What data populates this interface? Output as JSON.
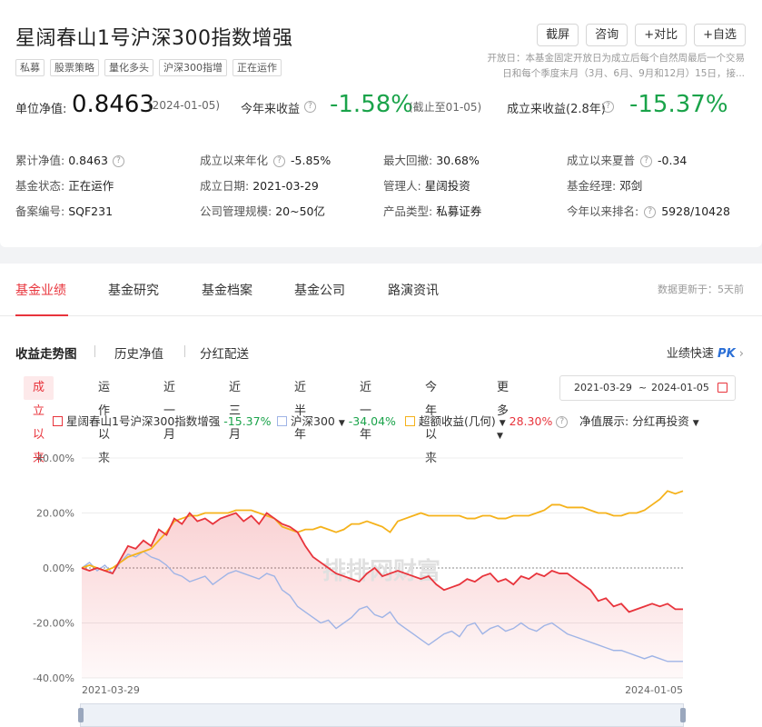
{
  "fund": {
    "title": "星阔春山1号沪深300指数增强",
    "buttons": [
      "截屏",
      "咨询",
      "+对比",
      "+自选"
    ],
    "tags": [
      "私募",
      "股票策略",
      "量化多头",
      "沪深300指增",
      "正在运作"
    ],
    "open_note": "开放日：本基金固定开放日为成立后每个自然周最后一个交易日和每个季度末月（3月、6月、9月和12月）15日，接..."
  },
  "summary": {
    "nav_label": "单位净值:",
    "nav_value": "0.8463",
    "nav_date": "(2024-01-05)",
    "ytd_label": "今年来收益",
    "ytd_value": "-1.58%",
    "ytd_note": "(截止至01-05)",
    "since_label": "成立来收益(2.8年)",
    "since_value": "-15.37%"
  },
  "details": [
    {
      "k": "累计净值:",
      "v": "0.8463",
      "q": true
    },
    {
      "k": "成立以来年化",
      "v": "-5.85%",
      "q": true
    },
    {
      "k": "最大回撤:",
      "v": "30.68%"
    },
    {
      "k": "成立以来夏普",
      "v": "-0.34",
      "q": true
    },
    {
      "k": "基金状态:",
      "v": "正在运作"
    },
    {
      "k": "成立日期:",
      "v": "2021-03-29"
    },
    {
      "k": "管理人:",
      "v": "星阔投资",
      "link": true
    },
    {
      "k": "基金经理:",
      "v": "邓剑",
      "link": true
    },
    {
      "k": "备案编号:",
      "v": "SQF231"
    },
    {
      "k": "公司管理规模:",
      "v": "20~50亿"
    },
    {
      "k": "产品类型:",
      "v": "私募证券"
    },
    {
      "k": "今年以来排名:",
      "v": "5928/10428",
      "q": true
    }
  ],
  "tabs": [
    "基金业绩",
    "基金研究",
    "基金档案",
    "基金公司",
    "路演资讯"
  ],
  "update_note": "数据更新于：5天前",
  "subtabs": [
    "收益走势图",
    "历史净值",
    "分红配送"
  ],
  "quick": {
    "label": "业绩快速",
    "pk": "PK"
  },
  "ranges": [
    "成立以来",
    "运作以来",
    "近一月",
    "近三月",
    "近半年",
    "近一年",
    "今年以来",
    "更多"
  ],
  "date_range": {
    "start": "2021-03-29",
    "sep": "~",
    "end": "2024-01-05"
  },
  "legend": {
    "fund_name": "星阔春山1号沪深300指数增强",
    "fund_val": "-15.37%",
    "index_name": "沪深300",
    "index_val": "-34.04%",
    "excess_name": "超额收益(几何)",
    "excess_val": "28.30%",
    "nav_show_label": "净值展示:",
    "nav_show_value": "分红再投资"
  },
  "colors": {
    "fund": "#e8343c",
    "index": "#9fb4e6",
    "excess": "#f5b21b",
    "up": "#e8343c",
    "down": "#1aa34a"
  },
  "chart_data": {
    "type": "line",
    "xlabel": "",
    "ylabel": "",
    "x_ticks": [
      "2021-03-29",
      "2024-01-05"
    ],
    "y_ticks": [
      "40.00%",
      "20.00%",
      "0.00%",
      "-20.00%",
      "-40.00%"
    ],
    "ylim": [
      -40,
      40
    ],
    "series": [
      {
        "name": "星阔春山1号沪深300指数增强",
        "values": [
          0,
          -1,
          0,
          -1,
          -2,
          3,
          8,
          7,
          10,
          8,
          14,
          12,
          18,
          16,
          20,
          17,
          18,
          16,
          18,
          19,
          20,
          17,
          19,
          16,
          20,
          18,
          16,
          15,
          13,
          8,
          4,
          2,
          0,
          -2,
          -3,
          -4,
          -5,
          -2,
          0,
          -3,
          -2,
          -1,
          -2,
          -3,
          -4,
          -3,
          -6,
          -8,
          -7,
          -6,
          -4,
          -5,
          -3,
          -2,
          -5,
          -4,
          -6,
          -3,
          -4,
          -2,
          -3,
          -1,
          -2,
          -2,
          -4,
          -6,
          -8,
          -12,
          -11,
          -14,
          -13,
          -16,
          -15,
          -14,
          -13,
          -14,
          -13,
          -15,
          -15
        ]
      },
      {
        "name": "沪深300",
        "values": [
          0,
          2,
          -1,
          1,
          -2,
          2,
          5,
          4,
          6,
          4,
          3,
          1,
          -2,
          -3,
          -5,
          -4,
          -3,
          -6,
          -4,
          -2,
          -1,
          -2,
          -3,
          -4,
          -2,
          -3,
          -8,
          -10,
          -14,
          -16,
          -18,
          -20,
          -19,
          -22,
          -20,
          -18,
          -15,
          -14,
          -17,
          -18,
          -16,
          -20,
          -22,
          -24,
          -26,
          -28,
          -26,
          -24,
          -23,
          -25,
          -21,
          -20,
          -24,
          -22,
          -21,
          -23,
          -22,
          -20,
          -22,
          -23,
          -21,
          -20,
          -22,
          -24,
          -25,
          -26,
          -27,
          -28,
          -29,
          -30,
          -30,
          -31,
          -32,
          -33,
          -32,
          -33,
          -34,
          -34,
          -34
        ]
      },
      {
        "name": "超额收益(几何)",
        "values": [
          0,
          1,
          0,
          -1,
          0,
          2,
          4,
          5,
          6,
          7,
          10,
          13,
          17,
          18,
          19,
          19,
          20,
          20,
          20,
          20,
          21,
          21,
          21,
          20,
          19,
          18,
          15,
          14,
          13,
          14,
          14,
          15,
          14,
          13,
          14,
          16,
          16,
          17,
          16,
          15,
          13,
          17,
          18,
          19,
          20,
          19,
          19,
          19,
          19,
          19,
          18,
          18,
          19,
          19,
          18,
          18,
          19,
          19,
          19,
          20,
          21,
          23,
          23,
          22,
          22,
          22,
          21,
          20,
          20,
          19,
          19,
          20,
          20,
          21,
          23,
          25,
          28,
          27,
          28
        ]
      }
    ]
  }
}
